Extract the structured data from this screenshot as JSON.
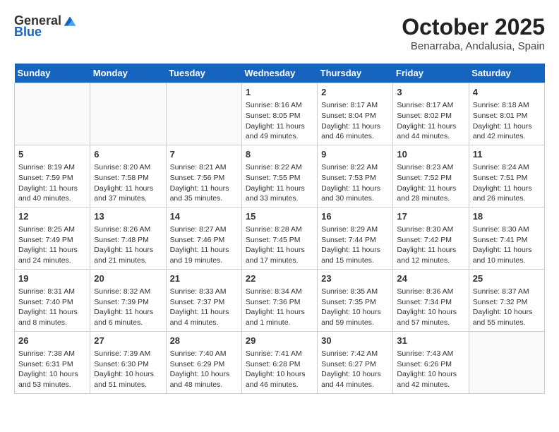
{
  "header": {
    "logo_general": "General",
    "logo_blue": "Blue",
    "month_title": "October 2025",
    "location": "Benarraba, Andalusia, Spain"
  },
  "weekdays": [
    "Sunday",
    "Monday",
    "Tuesday",
    "Wednesday",
    "Thursday",
    "Friday",
    "Saturday"
  ],
  "weeks": [
    [
      {
        "day": "",
        "info": ""
      },
      {
        "day": "",
        "info": ""
      },
      {
        "day": "",
        "info": ""
      },
      {
        "day": "1",
        "info": "Sunrise: 8:16 AM\nSunset: 8:05 PM\nDaylight: 11 hours and 49 minutes."
      },
      {
        "day": "2",
        "info": "Sunrise: 8:17 AM\nSunset: 8:04 PM\nDaylight: 11 hours and 46 minutes."
      },
      {
        "day": "3",
        "info": "Sunrise: 8:17 AM\nSunset: 8:02 PM\nDaylight: 11 hours and 44 minutes."
      },
      {
        "day": "4",
        "info": "Sunrise: 8:18 AM\nSunset: 8:01 PM\nDaylight: 11 hours and 42 minutes."
      }
    ],
    [
      {
        "day": "5",
        "info": "Sunrise: 8:19 AM\nSunset: 7:59 PM\nDaylight: 11 hours and 40 minutes."
      },
      {
        "day": "6",
        "info": "Sunrise: 8:20 AM\nSunset: 7:58 PM\nDaylight: 11 hours and 37 minutes."
      },
      {
        "day": "7",
        "info": "Sunrise: 8:21 AM\nSunset: 7:56 PM\nDaylight: 11 hours and 35 minutes."
      },
      {
        "day": "8",
        "info": "Sunrise: 8:22 AM\nSunset: 7:55 PM\nDaylight: 11 hours and 33 minutes."
      },
      {
        "day": "9",
        "info": "Sunrise: 8:22 AM\nSunset: 7:53 PM\nDaylight: 11 hours and 30 minutes."
      },
      {
        "day": "10",
        "info": "Sunrise: 8:23 AM\nSunset: 7:52 PM\nDaylight: 11 hours and 28 minutes."
      },
      {
        "day": "11",
        "info": "Sunrise: 8:24 AM\nSunset: 7:51 PM\nDaylight: 11 hours and 26 minutes."
      }
    ],
    [
      {
        "day": "12",
        "info": "Sunrise: 8:25 AM\nSunset: 7:49 PM\nDaylight: 11 hours and 24 minutes."
      },
      {
        "day": "13",
        "info": "Sunrise: 8:26 AM\nSunset: 7:48 PM\nDaylight: 11 hours and 21 minutes."
      },
      {
        "day": "14",
        "info": "Sunrise: 8:27 AM\nSunset: 7:46 PM\nDaylight: 11 hours and 19 minutes."
      },
      {
        "day": "15",
        "info": "Sunrise: 8:28 AM\nSunset: 7:45 PM\nDaylight: 11 hours and 17 minutes."
      },
      {
        "day": "16",
        "info": "Sunrise: 8:29 AM\nSunset: 7:44 PM\nDaylight: 11 hours and 15 minutes."
      },
      {
        "day": "17",
        "info": "Sunrise: 8:30 AM\nSunset: 7:42 PM\nDaylight: 11 hours and 12 minutes."
      },
      {
        "day": "18",
        "info": "Sunrise: 8:30 AM\nSunset: 7:41 PM\nDaylight: 11 hours and 10 minutes."
      }
    ],
    [
      {
        "day": "19",
        "info": "Sunrise: 8:31 AM\nSunset: 7:40 PM\nDaylight: 11 hours and 8 minutes."
      },
      {
        "day": "20",
        "info": "Sunrise: 8:32 AM\nSunset: 7:39 PM\nDaylight: 11 hours and 6 minutes."
      },
      {
        "day": "21",
        "info": "Sunrise: 8:33 AM\nSunset: 7:37 PM\nDaylight: 11 hours and 4 minutes."
      },
      {
        "day": "22",
        "info": "Sunrise: 8:34 AM\nSunset: 7:36 PM\nDaylight: 11 hours and 1 minute."
      },
      {
        "day": "23",
        "info": "Sunrise: 8:35 AM\nSunset: 7:35 PM\nDaylight: 10 hours and 59 minutes."
      },
      {
        "day": "24",
        "info": "Sunrise: 8:36 AM\nSunset: 7:34 PM\nDaylight: 10 hours and 57 minutes."
      },
      {
        "day": "25",
        "info": "Sunrise: 8:37 AM\nSunset: 7:32 PM\nDaylight: 10 hours and 55 minutes."
      }
    ],
    [
      {
        "day": "26",
        "info": "Sunrise: 7:38 AM\nSunset: 6:31 PM\nDaylight: 10 hours and 53 minutes."
      },
      {
        "day": "27",
        "info": "Sunrise: 7:39 AM\nSunset: 6:30 PM\nDaylight: 10 hours and 51 minutes."
      },
      {
        "day": "28",
        "info": "Sunrise: 7:40 AM\nSunset: 6:29 PM\nDaylight: 10 hours and 48 minutes."
      },
      {
        "day": "29",
        "info": "Sunrise: 7:41 AM\nSunset: 6:28 PM\nDaylight: 10 hours and 46 minutes."
      },
      {
        "day": "30",
        "info": "Sunrise: 7:42 AM\nSunset: 6:27 PM\nDaylight: 10 hours and 44 minutes."
      },
      {
        "day": "31",
        "info": "Sunrise: 7:43 AM\nSunset: 6:26 PM\nDaylight: 10 hours and 42 minutes."
      },
      {
        "day": "",
        "info": ""
      }
    ]
  ]
}
